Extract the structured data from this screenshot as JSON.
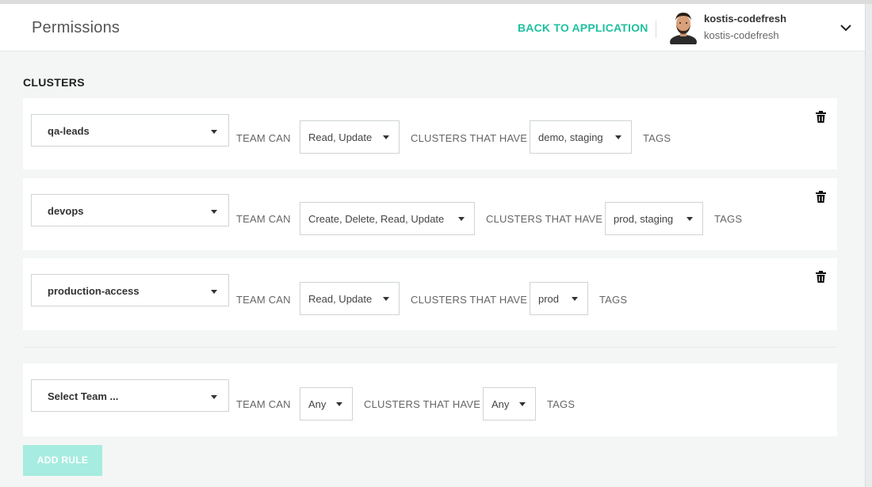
{
  "header": {
    "title": "Permissions",
    "back_link": "BACK TO APPLICATION",
    "user": {
      "name": "kostis-codefresh",
      "account": "kostis-codefresh"
    }
  },
  "section": {
    "title": "CLUSTERS"
  },
  "labels": {
    "team_can": "TEAM CAN",
    "clusters_that_have": "CLUSTERS THAT HAVE",
    "tags": "TAGS"
  },
  "rules": [
    {
      "team": "qa-leads",
      "permissions": "Read, Update",
      "tags": "demo, staging"
    },
    {
      "team": "devops",
      "permissions": "Create, Delete, Read, Update",
      "tags": "prod, staging"
    },
    {
      "team": "production-access",
      "permissions": "Read, Update",
      "tags": "prod"
    }
  ],
  "new_rule": {
    "team_placeholder": "Select Team ...",
    "permissions": "Any",
    "tags": "Any"
  },
  "add_rule_label": "ADD RULE",
  "colors": {
    "accent": "#1fc0a0",
    "add_button": "#a7ece0",
    "background": "#f3f6f5"
  },
  "icons": {
    "trash": "trash-icon",
    "chevron": "chevron-down-icon",
    "caret": "caret-down-icon"
  }
}
